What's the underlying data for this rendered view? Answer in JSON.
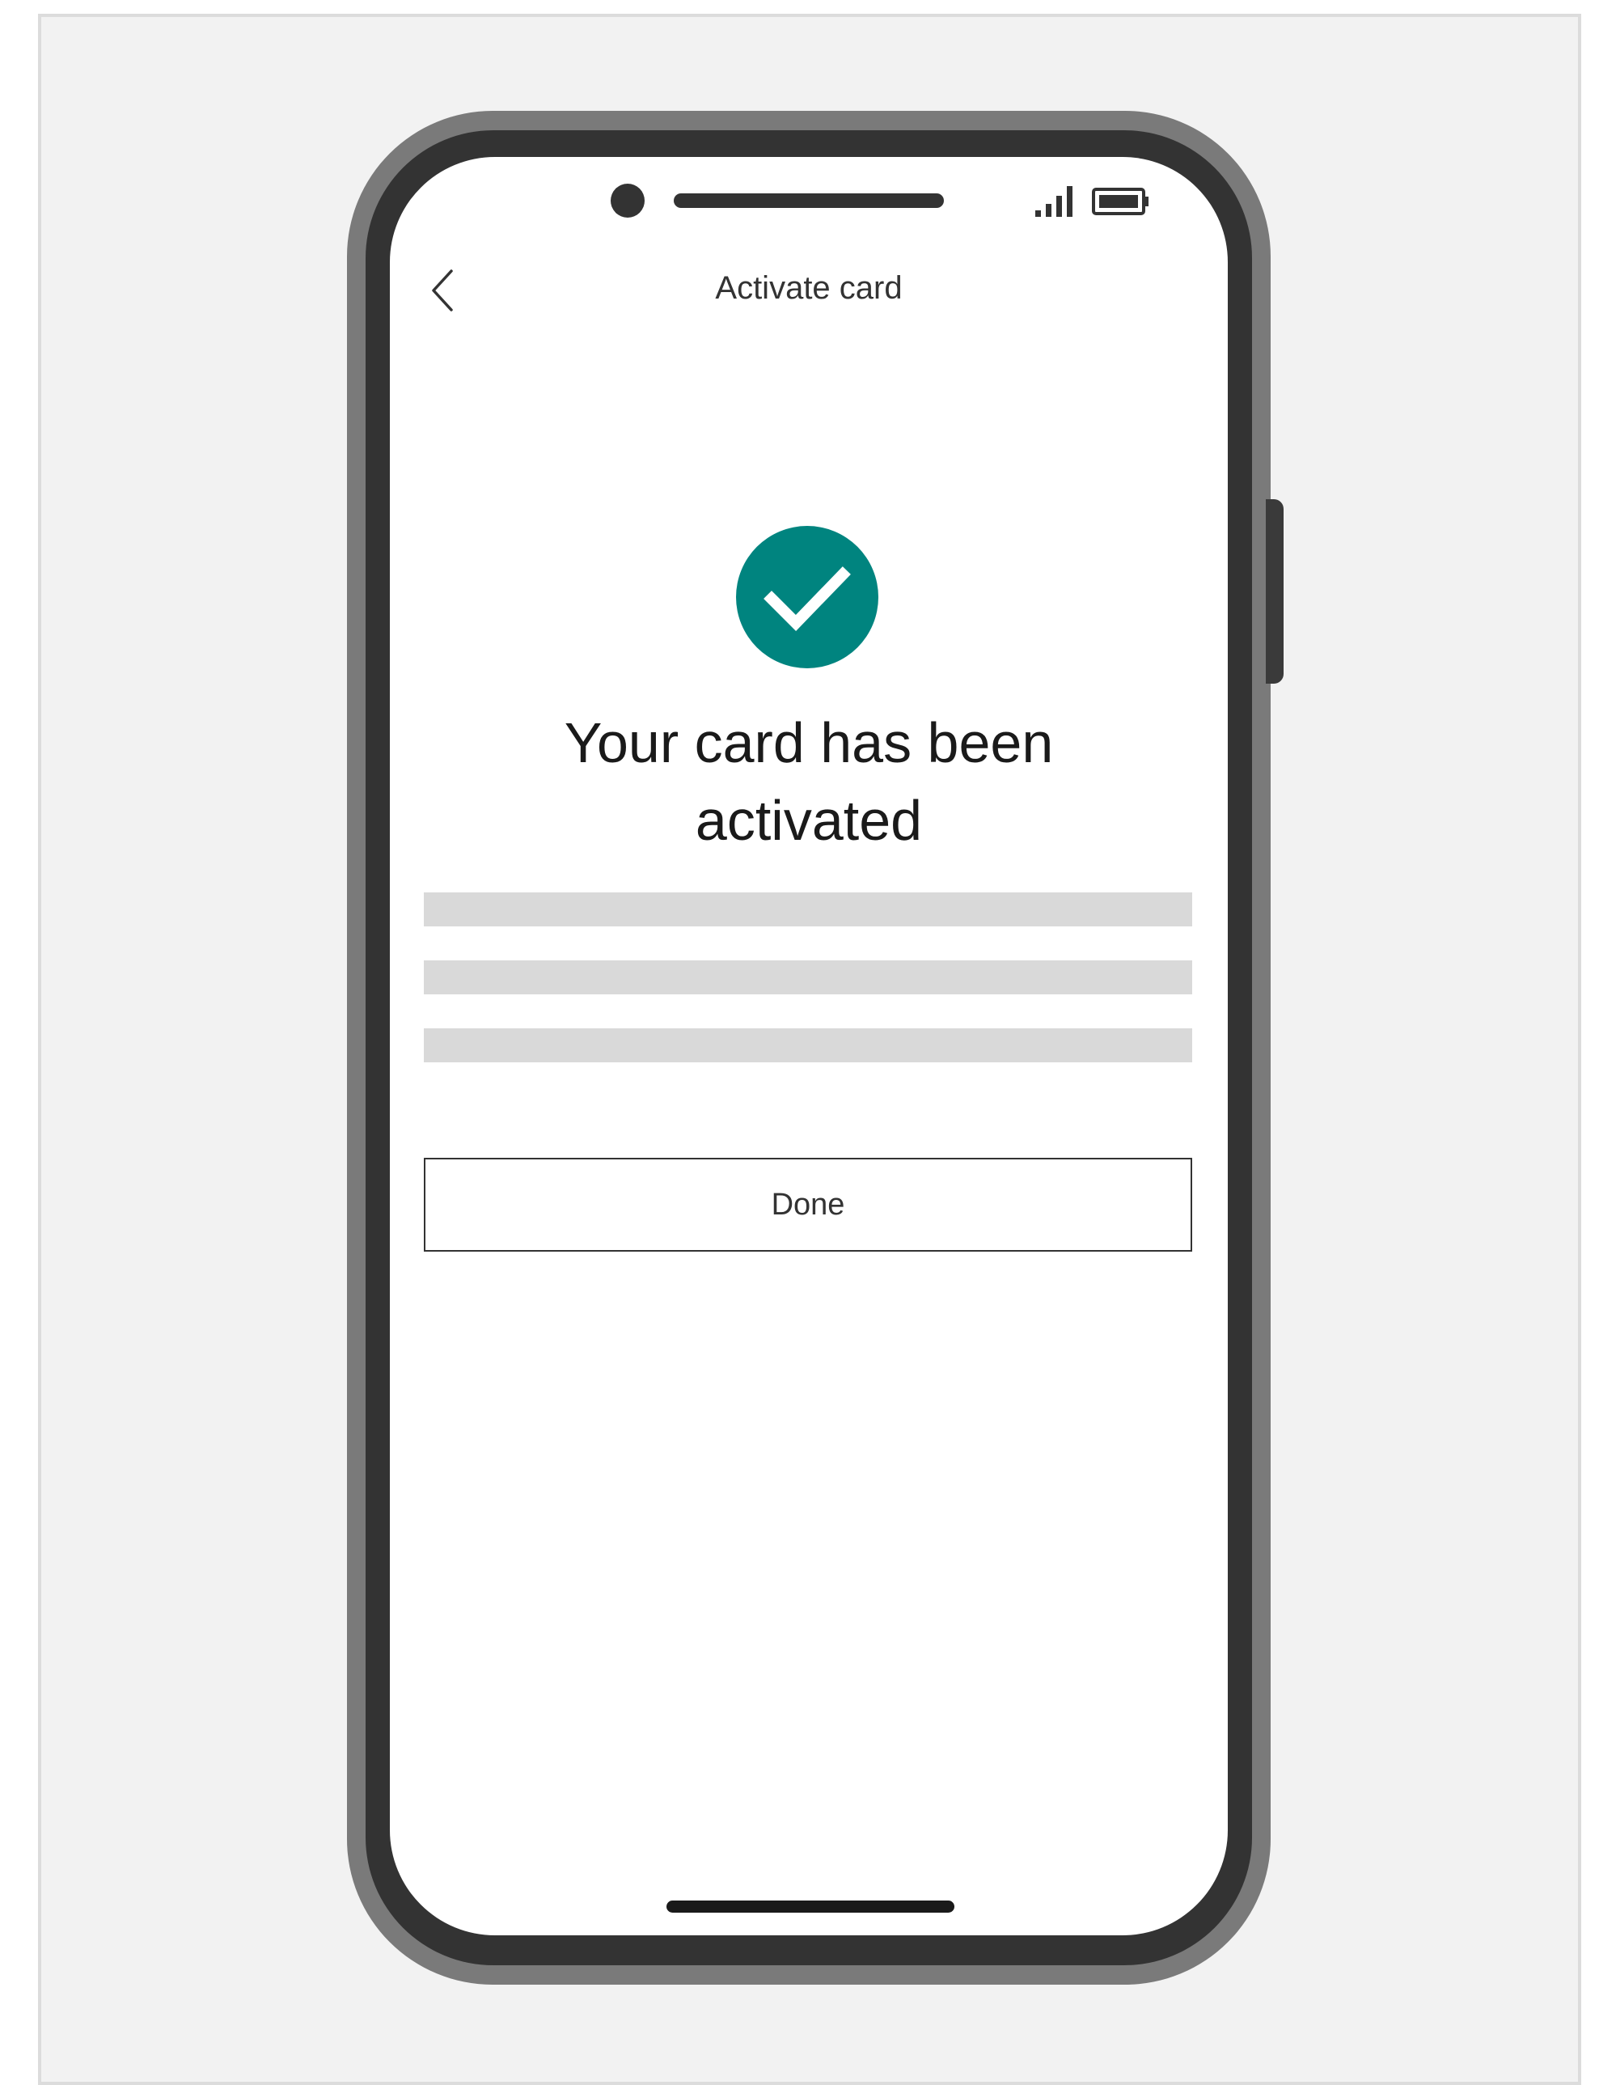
{
  "header": {
    "title": "Activate card",
    "back_icon": "chevron-left-icon"
  },
  "status_bar": {
    "signal_icon": "signal-icon",
    "battery_icon": "battery-icon"
  },
  "confirmation": {
    "icon": "check-circle-icon",
    "icon_color": "#00847f",
    "headline_line1": "Your card has been",
    "headline_line2": "activated"
  },
  "actions": {
    "done_label": "Done"
  }
}
